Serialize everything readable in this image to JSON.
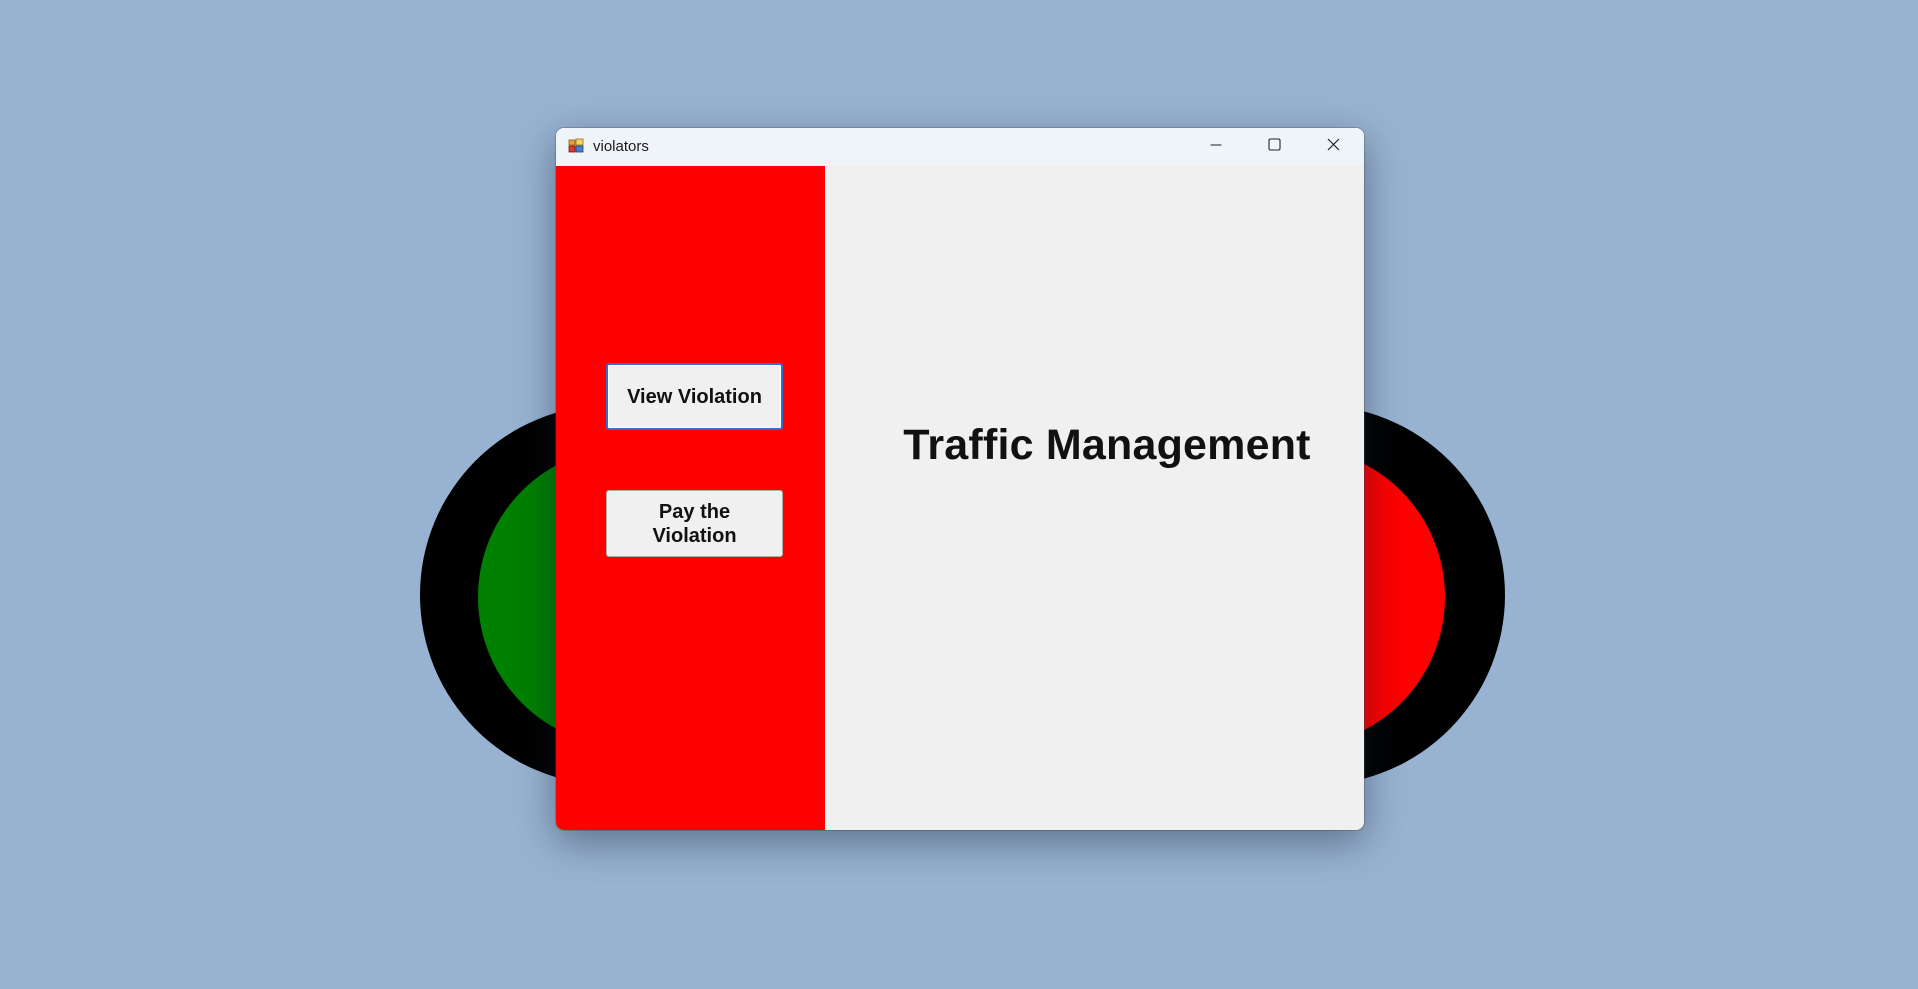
{
  "background": {
    "color": "#98b3d1",
    "traffic_lights": [
      {
        "lamp_color": "#008000"
      },
      {
        "lamp_color": "#ff0000"
      }
    ]
  },
  "window": {
    "title": "violators",
    "icon": "app-icon",
    "controls": {
      "minimize_icon": "minimize-icon",
      "maximize_icon": "maximize-icon",
      "close_icon": "close-icon"
    }
  },
  "sidebar": {
    "color": "#ff0000",
    "buttons": [
      {
        "label": "View Violation"
      },
      {
        "label": "Pay the Violation"
      }
    ]
  },
  "main": {
    "heading": "Traffic Management"
  }
}
